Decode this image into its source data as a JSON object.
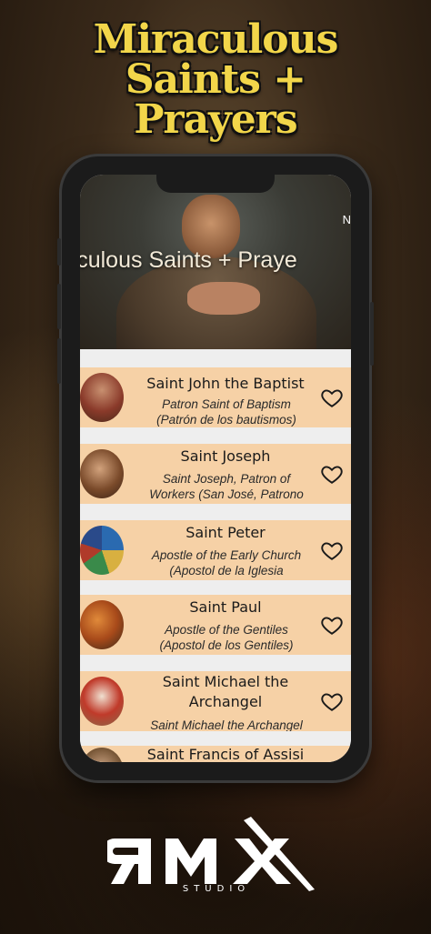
{
  "promo": {
    "headline_line1": "Miraculous",
    "headline_line2": "Saints +",
    "headline_line3": "Prayers"
  },
  "app": {
    "hero_title": "raculous Saints + Praye",
    "hero_corner_text": "N"
  },
  "saints": [
    {
      "name": "Saint John the Baptist",
      "subtitle_line1": "Patron Saint of Baptism",
      "subtitle_line2": "(Patrón de los bautismos)"
    },
    {
      "name": "Saint Joseph",
      "subtitle_line1": "Saint Joseph, Patron of",
      "subtitle_line2": "Workers (San José, Patrono"
    },
    {
      "name": "Saint Peter",
      "subtitle_line1": "Apostle of the Early Church",
      "subtitle_line2": "(Apostol de la Iglesia"
    },
    {
      "name": "Saint Paul",
      "subtitle_line1": "Apostle of the Gentiles",
      "subtitle_line2": "(Apostol de los Gentiles)"
    },
    {
      "name_line1": "Saint Michael the",
      "name_line2": "Archangel",
      "subtitle_line1": "Saint Michael the Archangel"
    },
    {
      "name": "Saint Francis of Assisi"
    }
  ],
  "brand": {
    "logo_text": "RMX",
    "logo_subtext": "STUDIO"
  },
  "colors": {
    "headline": "#f2d64a",
    "card_background": "#f6d1a6",
    "list_background": "#eeeeee"
  },
  "icons": {
    "favorite": "heart-outline-icon"
  }
}
